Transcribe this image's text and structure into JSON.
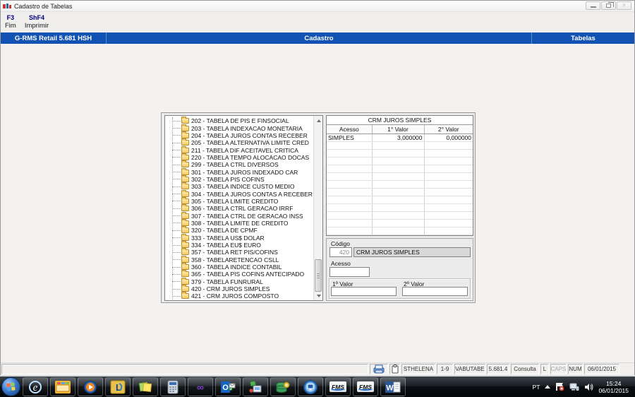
{
  "window": {
    "title": "Cadastro de Tabelas"
  },
  "icons": {
    "minimize": "minimize",
    "restore": "restore",
    "close": "close"
  },
  "menu": {
    "items": [
      {
        "key": "F3",
        "label": "Fim"
      },
      {
        "key": "ShF4",
        "label": "Imprimir"
      }
    ]
  },
  "header_bar": {
    "left": "G-RMS Retail 5.681 HSH",
    "center": "Cadastro",
    "right": "Tabelas",
    "bg_color": "#1252b2"
  },
  "tree": {
    "items": [
      "202 - TABELA DE PIS E FINSOCIAL",
      "203 - TABELA INDEXACAO MONETARIA",
      "204 - TABELA JUROS CONTAS RECEBER",
      "205 - TABELA ALTERNATIVA LIMITE CRED",
      "211 - TABELA DIF ACEITAVEL  CRITICA",
      "220 - TABELA TEMPO ALOCACAO  DOCAS",
      "299 - TABELA CTRL DIVERSOS",
      "301 - TABELA JUROS INDEXADO CAR",
      "302 - TABELA PIS COFINS",
      "303 - TABELA INDICE CUSTO MEDIO",
      "304 - TABELA JUROS CONTAS A RECEBER",
      "305 - TABELA LIMITE CREDITO",
      "306 - TABELA CTRL GERACAO IRRF",
      "307 - TABELA CTRL DE GERACAO INSS",
      "308 - TABELA LIMITE DE CREDITO",
      "320 - TABELA DE CPMF",
      "333 - TABELA US$ DOLAR",
      "334 - TABELA EU$ EURO",
      "357 - TABELA RET PIS/COFINS",
      "358 - TABELARETENCAO CSLL",
      "360 - TABELA INDICE CONTABIL",
      "365 - TABELA PIS COFINS ANTECIPADO",
      "379 - TABELA FUNRURAL",
      "420 - CRM JUROS SIMPLES",
      "421 - CRM JUROS COMPOSTO"
    ]
  },
  "grid": {
    "title": "CRM JUROS SIMPLES",
    "columns": [
      "Acesso",
      "1° Valor",
      "2° Valor"
    ],
    "rows": [
      [
        "SIMPLES",
        "3,000000",
        "0,000000"
      ]
    ],
    "empty_row_count": 13
  },
  "form": {
    "codigo_label": "Código",
    "codigo_value": "420",
    "codigo_desc": "CRM JUROS SIMPLES",
    "acesso_label": "Acesso",
    "acesso_value": "",
    "valor1_label": "1º Valor",
    "valor1_value": "",
    "valor2_label": "2º Valor",
    "valor2_value": ""
  },
  "status_bar": {
    "icon_cells": [
      "printer-icon",
      "clipboard-icon"
    ],
    "cells": [
      {
        "text": "STHELENA",
        "dim": false
      },
      {
        "text": "1-9",
        "dim": false
      },
      {
        "text": "VABUTABE",
        "dim": false
      },
      {
        "text": "5.681.4",
        "dim": false
      },
      {
        "text": "Consulta",
        "dim": false
      },
      {
        "text": "L",
        "dim": false
      },
      {
        "text": "CAPS",
        "dim": true
      },
      {
        "text": "NUM",
        "dim": false
      },
      {
        "text": "06/01/2015",
        "dim": false
      }
    ]
  },
  "taskbar": {
    "buttons": [
      {
        "name": "internet-explorer",
        "kind": "ie",
        "label": ""
      },
      {
        "name": "windows-explorer",
        "kind": "explorer",
        "label": ""
      },
      {
        "name": "media-player",
        "kind": "wmp",
        "label": ""
      },
      {
        "name": "lotus-app",
        "kind": "lotus",
        "label": "L"
      },
      {
        "name": "sticky-notes",
        "kind": "notes",
        "label": ""
      },
      {
        "name": "calculator",
        "kind": "calc",
        "label": ""
      },
      {
        "name": "co-app",
        "kind": "co",
        "label": "co"
      },
      {
        "name": "outlook",
        "kind": "outlook",
        "label": "O"
      },
      {
        "name": "setup-tool",
        "kind": "tools",
        "label": ""
      },
      {
        "name": "database-tool",
        "kind": "database",
        "label": ""
      },
      {
        "name": "remote-desktop",
        "kind": "remote",
        "label": ""
      },
      {
        "name": "fms-app-1",
        "kind": "fms",
        "label": "FMS"
      },
      {
        "name": "fms-app-2",
        "kind": "fms",
        "label": "FMS"
      },
      {
        "name": "word",
        "kind": "word",
        "label": "W"
      }
    ],
    "tray": {
      "lang": "PT",
      "time": "15:24",
      "date": "06/01/2015"
    }
  }
}
